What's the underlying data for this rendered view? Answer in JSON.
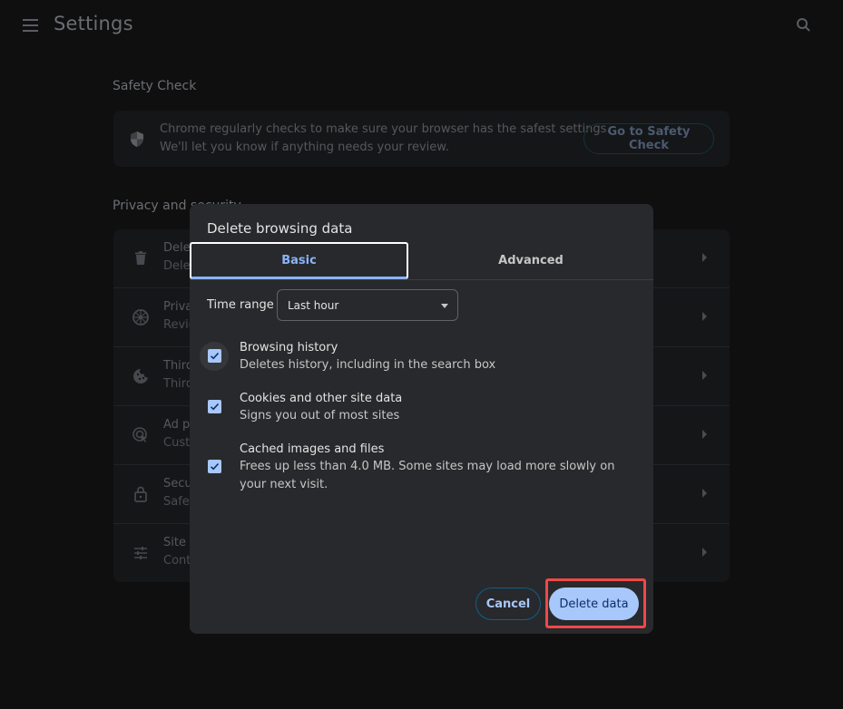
{
  "header": {
    "title": "Settings",
    "menu_icon": "hamburger-menu-icon",
    "search_icon": "search-icon"
  },
  "safety_check": {
    "section_title": "Safety Check",
    "icon": "shield-icon",
    "line1": "Chrome regularly checks to make sure your browser has the safest settings.",
    "line2": "We'll let you know if anything needs your review.",
    "button_label": "Go to Safety Check"
  },
  "privacy": {
    "section_title": "Privacy and security",
    "rows": [
      {
        "icon": "trash-icon",
        "title": "Delete browsing data",
        "subtitle": "Delete history, cookies, cache, and more"
      },
      {
        "icon": "privacy-guide-icon",
        "title": "Privacy guide",
        "subtitle": "Review key privacy and security controls"
      },
      {
        "icon": "cookie-icon",
        "title": "Third-party cookies",
        "subtitle": "Third-party cookies are blocked in Incognito mode"
      },
      {
        "icon": "ad-privacy-icon",
        "title": "Ad privacy",
        "subtitle": "Customize the info used by sites to show you ads"
      },
      {
        "icon": "lock-icon",
        "title": "Security",
        "subtitle": "Safe Browsing (protection from dangerous sites) and other security settings"
      },
      {
        "icon": "site-settings-icon",
        "title": "Site settings",
        "subtitle": "Controls what information sites can use and show"
      }
    ]
  },
  "dialog": {
    "title": "Delete browsing data",
    "tabs": [
      {
        "label": "Basic",
        "selected": true
      },
      {
        "label": "Advanced",
        "selected": false
      }
    ],
    "time_range": {
      "label": "Time range",
      "value": "Last hour"
    },
    "options": [
      {
        "title": "Browsing history",
        "description": "Deletes history, including in the search box",
        "checked": true
      },
      {
        "title": "Cookies and other site data",
        "description": "Signs you out of most sites",
        "checked": true
      },
      {
        "title": "Cached images and files",
        "description": "Frees up less than 4.0 MB. Some sites may load more slowly on your next visit.",
        "checked": true
      }
    ],
    "cancel_label": "Cancel",
    "delete_label": "Delete data"
  },
  "colors": {
    "accent": "#a8c7fa",
    "tab_active": "#8ab4f8",
    "highlight": "#f04848"
  }
}
